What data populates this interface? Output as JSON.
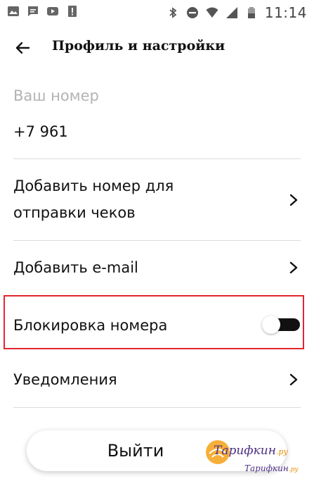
{
  "status_bar": {
    "time": "11:14",
    "left_icons": [
      "image-icon",
      "message-icon",
      "youtube-icon",
      "alert-icon"
    ],
    "right_icons": [
      "bluetooth-icon",
      "do-not-disturb-icon",
      "wifi-icon",
      "signal-icon",
      "battery-icon"
    ]
  },
  "header": {
    "title": "Профиль и настройки",
    "back_icon": "arrow-left-icon"
  },
  "profile": {
    "number_label": "Ваш номер",
    "number_value": "+7 961"
  },
  "menu": {
    "add_receipt_number_line1": "Добавить номер для",
    "add_receipt_number_line2": "отправки чеков",
    "add_email": "Добавить e-mail",
    "block_number": "Блокировка номера",
    "block_number_enabled": true,
    "notifications": "Уведомления"
  },
  "actions": {
    "logout_label": "Выйти"
  },
  "watermark": {
    "main": "Тарифкин",
    "main_suffix": ".ру",
    "sub": "Тарифкин",
    "sub_suffix": ".ру"
  },
  "colors": {
    "highlight": "#e2262f",
    "muted_text": "#b3b3b3",
    "toggle_on": "#111111"
  }
}
